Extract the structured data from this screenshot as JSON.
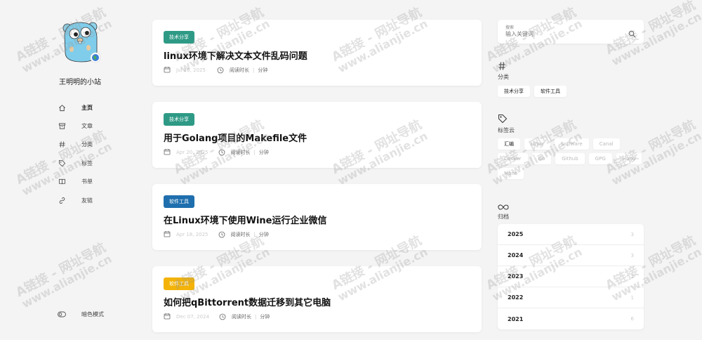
{
  "site": {
    "title": "王明明的小站"
  },
  "nav": [
    {
      "label": "主页",
      "icon": "home-icon"
    },
    {
      "label": "文章",
      "icon": "archive-box-icon"
    },
    {
      "label": "分类",
      "icon": "hash-icon"
    },
    {
      "label": "标签",
      "icon": "tag-icon"
    },
    {
      "label": "书单",
      "icon": "book-icon"
    },
    {
      "label": "友链",
      "icon": "link-icon"
    }
  ],
  "theme_toggle": {
    "label": "暗色模式",
    "icon": "toggle-icon"
  },
  "posts": [
    {
      "tag": "技术分享",
      "tag_color": "#2e9a86",
      "title": "linux环境下解决文本文件乱码问题",
      "date": "Jul 26, 2025",
      "read_label": "阅读时长",
      "minutes_unit": "分钟"
    },
    {
      "tag": "技术分享",
      "tag_color": "#2e9a86",
      "title": "用于Golang项目的Makefile文件",
      "date": "Apr 20, 2025",
      "read_label": "阅读时长",
      "minutes_unit": "分钟"
    },
    {
      "tag": "软件工具",
      "tag_color": "#1f6fae",
      "title": "在Linux环境下使用Wine运行企业微信",
      "date": "Apr 18, 2025",
      "read_label": "阅读时长",
      "minutes_unit": "分钟"
    },
    {
      "tag": "软件工具",
      "tag_color": "#f3b308",
      "title": "如何把qBittorrent数据迁移到其它电脑",
      "date": "Dec 07, 2024",
      "read_label": "阅读时长",
      "minutes_unit": "分钟"
    }
  ],
  "search": {
    "label": "搜索",
    "placeholder": "输入关键词"
  },
  "categories": {
    "title": "分类",
    "items": [
      "技术分享",
      "软件工具"
    ]
  },
  "tag_cloud": {
    "title": "标签云",
    "items": [
      "汇编",
      "Linux",
      "Software",
      "Canal",
      "Docker",
      "Go",
      "Github",
      "GPG",
      "Hugo",
      "Mono"
    ]
  },
  "archive": {
    "title": "归档",
    "years": [
      {
        "year": "2025",
        "count": "3"
      },
      {
        "year": "2024",
        "count": "3"
      },
      {
        "year": "2023",
        "count": "2"
      },
      {
        "year": "2022",
        "count": "1"
      },
      {
        "year": "2021",
        "count": "6"
      }
    ]
  },
  "watermark": {
    "line1": "A链接 - 网址导航",
    "line2": "www.alianjie.cn"
  }
}
